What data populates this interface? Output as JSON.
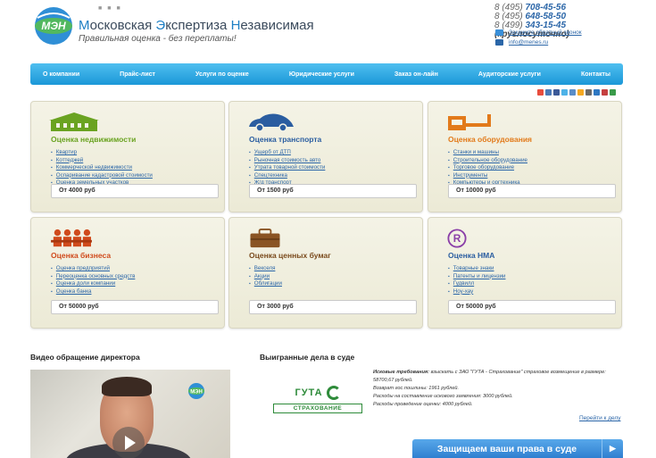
{
  "header": {
    "logo_text": "МЭН",
    "title_parts": [
      {
        "cap": "М",
        "rest": "осковская "
      },
      {
        "cap": "Э",
        "rest": "кспертиза "
      },
      {
        "cap": "Н",
        "rest": "езависимая"
      }
    ],
    "slogan": "Правильная оценка - без переплаты!",
    "phones": [
      {
        "prefix": "8 (495) ",
        "number": "708-45-56",
        "note": ""
      },
      {
        "prefix": "8 (495) ",
        "number": "648-58-50",
        "note": ""
      },
      {
        "prefix": "8 (499) ",
        "number": "343-15-45",
        "note": " (круглосуточно)"
      }
    ],
    "callback_label": "Закажите обратный звонок",
    "email": "info@menes.ru"
  },
  "nav": [
    "О компании",
    "Прайс-лист",
    "Услуги по оценке",
    "Юридические услуги",
    "Заказ он-лайн",
    "Аудиторские услуги",
    "Контакты"
  ],
  "social_colors": [
    "#e84d3d",
    "#4a7ab8",
    "#3b5998",
    "#4eb3e8",
    "#5a8dc8",
    "#f6a821",
    "#6a6a6a",
    "#2f78c2",
    "#c54040",
    "#3a9b4a"
  ],
  "cards": [
    {
      "title": "Оценка недвижимости",
      "title_color": "#6aa321",
      "icon": "building-icon",
      "items": [
        "Квартир",
        "Коттеджей",
        "Коммерческой недвижимости",
        "Оспаривание кадастровой стоимости",
        "Оценка земельных участков"
      ],
      "price": "От 4000 руб"
    },
    {
      "title": "Оценка транспорта",
      "title_color": "#2a5da0",
      "icon": "car-icon",
      "items": [
        "Ущерб от ДТП",
        "Рыночная стоимость авто",
        "Утрата товарной стоимости",
        "Спецтехника",
        "Ж/д транспорт"
      ],
      "price": "От 1500 руб"
    },
    {
      "title": "Оценка оборудования",
      "title_color": "#e27a1a",
      "icon": "equipment-icon",
      "items": [
        "Станки и машины",
        "Строительное оборудование",
        "Торговое оборудование",
        "Инструменты",
        "Компьютеры и оргтехника"
      ],
      "price": "От 10000 руб"
    },
    {
      "title": "Оценка бизнеса",
      "title_color": "#d04a1c",
      "icon": "business-people-icon",
      "items": [
        "Оценка предприятий",
        "Переоценка основных средств",
        "Оценка доли компании",
        "Оценка банка"
      ],
      "price": "От 50000 руб"
    },
    {
      "title": "Оценка ценных бумаг",
      "title_color": "#7a4a1c",
      "icon": "briefcase-icon",
      "items": [
        "Векселя",
        "Акции",
        "Облигации"
      ],
      "price": "От 3000 руб"
    },
    {
      "title": "Оценка НМА",
      "title_color": "#2a5da0",
      "icon": "registered-icon",
      "items": [
        "Товарные знаки",
        "Патенты и лицензии",
        "Гудвилл",
        "Ноу-хау"
      ],
      "price": "От 50000 руб"
    }
  ],
  "video": {
    "title": "Видео обращение директора"
  },
  "cases": {
    "title": "Выигранные дела в суде",
    "partner_name": "ГУТА",
    "partner_sub": "СТРАХОВАНИЕ",
    "lines": [
      {
        "label": "Исковые требования:",
        "text": " взыскать с ЗАО \"ГУТА - Страхование\" страховое возмещение в размере: 58700,67 рублей."
      },
      {
        "label": "",
        "text": "Возврат гос.пошлины: 1961 рублей."
      },
      {
        "label": "",
        "text": "Расходы на составление искового заявления: 3000 рублей."
      },
      {
        "label": "",
        "text": "Расходы проведение оценки: 4000 рублей."
      }
    ],
    "more_link": "Перейти к делу",
    "cta_label": "Защищаем ваши права в суде",
    "cta_arrow": "▶"
  }
}
